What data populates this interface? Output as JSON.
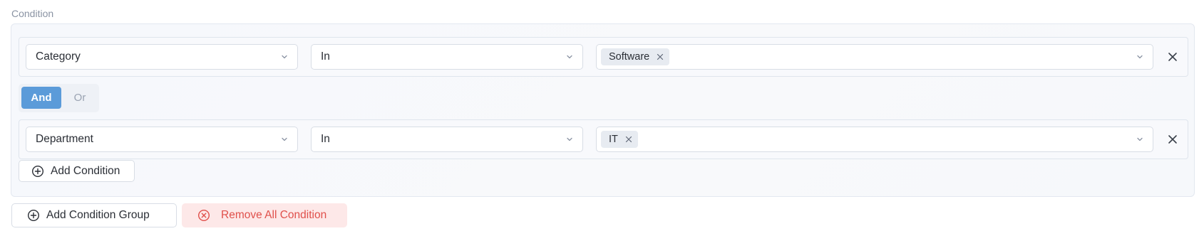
{
  "condition_label": "Condition",
  "rows": [
    {
      "field": "Category",
      "operator": "In",
      "tags": [
        "Software"
      ]
    },
    {
      "field": "Department",
      "operator": "In",
      "tags": [
        "IT"
      ]
    }
  ],
  "logic": {
    "and_label": "And",
    "or_label": "Or",
    "selected": "And"
  },
  "add_condition_label": "Add Condition",
  "footer": {
    "add_group_label": "Add Condition Group",
    "remove_all_label": "Remove All Condition"
  },
  "colors": {
    "accent": "#5b9bd9",
    "danger": "#e0504b",
    "danger_bg": "#fde8e8",
    "tag_bg": "#e7ebf1"
  },
  "icons": {
    "chevron": "chevron-down-icon",
    "tag_remove": "close-icon",
    "row_remove": "close-icon",
    "add": "plus-circle-icon",
    "remove_all": "x-circle-icon"
  }
}
